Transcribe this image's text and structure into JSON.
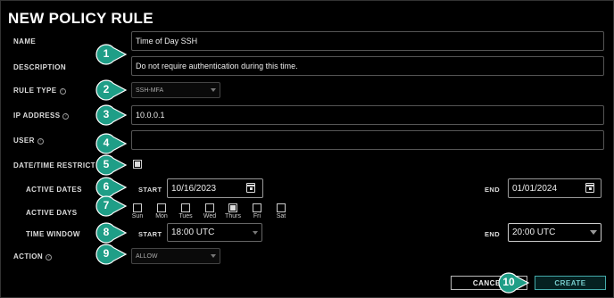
{
  "title": "NEW POLICY RULE",
  "labels": {
    "name": "NAME",
    "description": "DESCRIPTION",
    "rule_type": "RULE TYPE",
    "ip_address": "IP ADDRESS",
    "user": "USER",
    "datetime": "DATE/TIME RESTRICT",
    "active_dates": "ACTIVE DATES",
    "active_days": "ACTIVE DAYS",
    "time_window": "TIME WINDOW",
    "action": "ACTION",
    "start": "START",
    "end": "END"
  },
  "fields": {
    "name": "Time of Day SSH",
    "description": "Do not require authentication during this time.",
    "rule_type": "SSH-MFA",
    "ip_address": "10.0.0.1",
    "user": "",
    "start_date": "10/16/2023",
    "end_date": "01/01/2024",
    "start_time": "18:00 UTC",
    "end_time": "20:00 UTC",
    "action": "ALLOW"
  },
  "datetime_checked": true,
  "days": [
    {
      "label": "Sun",
      "checked": false
    },
    {
      "label": "Mon",
      "checked": false
    },
    {
      "label": "Tues",
      "checked": false
    },
    {
      "label": "Wed",
      "checked": false
    },
    {
      "label": "Thurs",
      "checked": true
    },
    {
      "label": "Fri",
      "checked": false
    },
    {
      "label": "Sat",
      "checked": false
    }
  ],
  "buttons": {
    "cancel": "CANCEL",
    "create": "CREATE"
  },
  "badges": [
    "1",
    "2",
    "3",
    "4",
    "5",
    "6",
    "7",
    "8",
    "9",
    "10"
  ],
  "colors": {
    "badge": "#1f9e87",
    "accent": "#46a8a8"
  },
  "icons": [
    "help-icon",
    "caret-down-icon",
    "calendar-icon",
    "checkbox-icon"
  ]
}
